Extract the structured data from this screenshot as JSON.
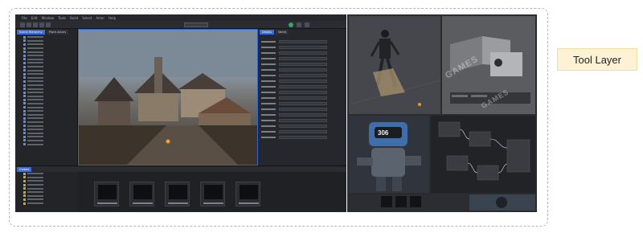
{
  "figure": {
    "label": "Tool Layer"
  },
  "editor": {
    "menu_items": [
      "File",
      "Edit",
      "Window",
      "Tools",
      "Build",
      "Select",
      "Actor",
      "Help"
    ],
    "outliner_tabs": [
      {
        "label": "Scene Hierarchy",
        "active": true
      },
      {
        "label": "Place Actors",
        "active": false
      }
    ],
    "details_tabs": [
      {
        "label": "Details",
        "active": true
      },
      {
        "label": "World",
        "active": false
      }
    ],
    "content_tab": "Content",
    "asset_count": 5
  },
  "thumbnails": {
    "tile_3_badge": "306"
  },
  "watermarks": [
    "GAMES",
    "GAMES"
  ],
  "colors": {
    "accent_blue": "#3c6cd6",
    "callout_fill": "#fdf3d4",
    "frame_border": "#b5b5b5"
  }
}
